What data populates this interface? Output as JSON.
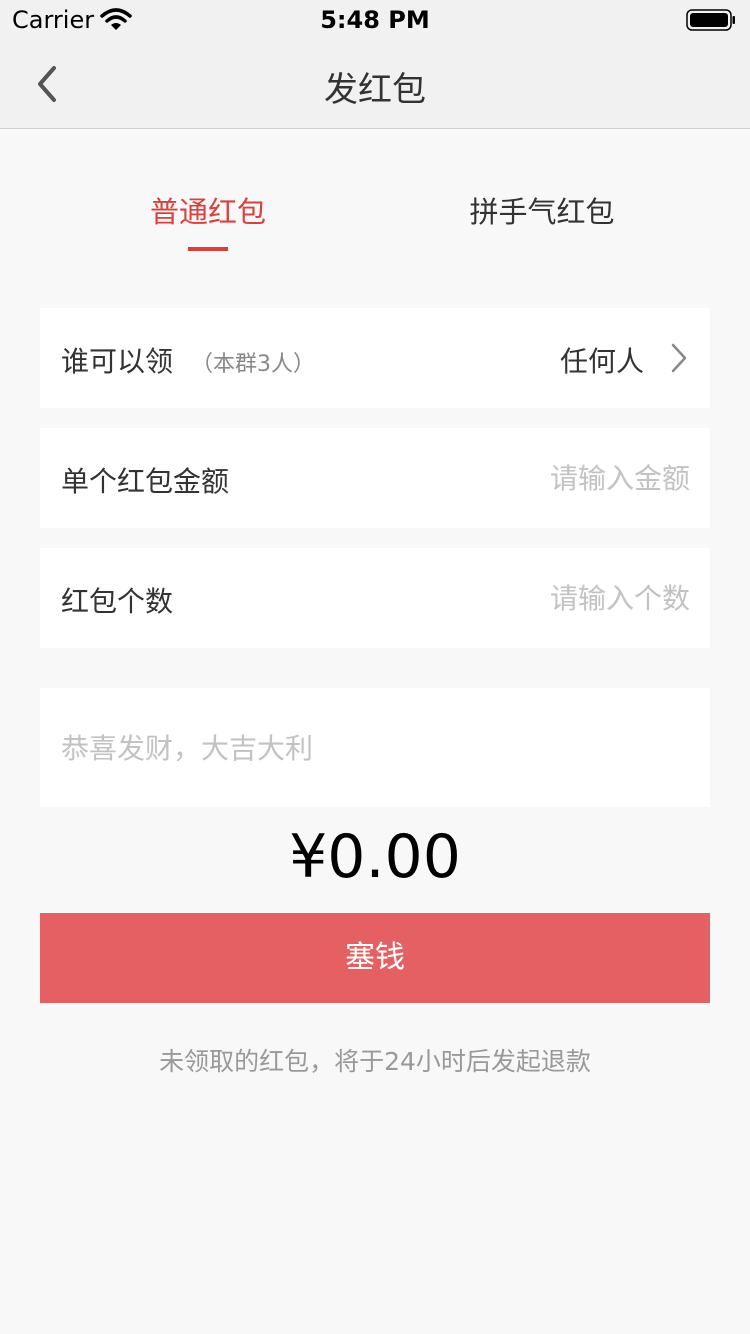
{
  "status_bar": {
    "carrier": "Carrier",
    "time": "5:48 PM"
  },
  "nav": {
    "title": "发红包",
    "back_icon": "chevron-left-icon"
  },
  "tabs": [
    {
      "label": "普通红包",
      "active": true
    },
    {
      "label": "拼手气红包",
      "active": false
    }
  ],
  "recipient_row": {
    "label": "谁可以领",
    "sub": "（本群3人）",
    "value": "任何人"
  },
  "amount_row": {
    "label": "单个红包金额",
    "placeholder": "请输入金额"
  },
  "count_row": {
    "label": "红包个数",
    "placeholder": "请输入个数"
  },
  "message": {
    "placeholder": "恭喜发财，大吉大利"
  },
  "total": "¥0.00",
  "submit_label": "塞钱",
  "notice": "未领取的红包，将于24小时后发起退款",
  "colors": {
    "accent": "#d9413e",
    "button": "#e56062",
    "background": "#f8f8f8"
  }
}
